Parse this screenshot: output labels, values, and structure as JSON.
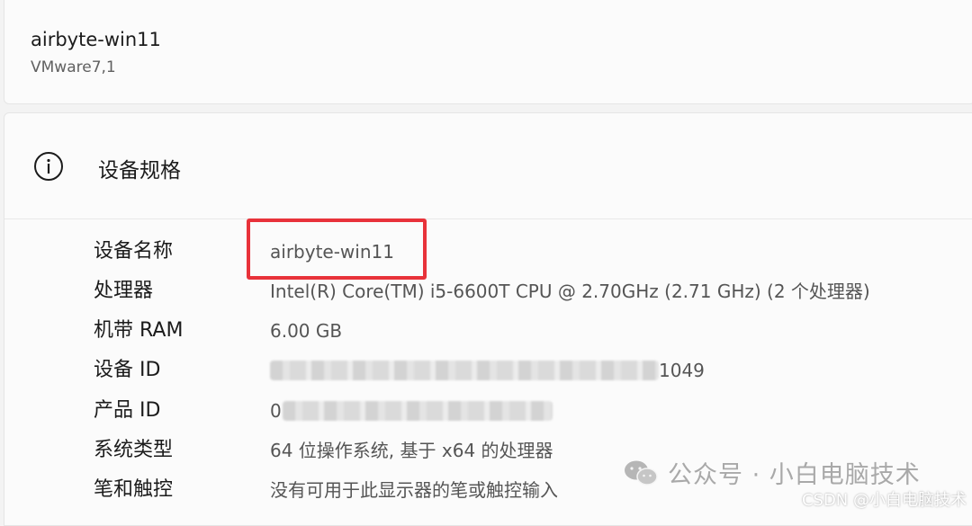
{
  "device": {
    "name": "airbyte-win11",
    "model": "VMware7,1"
  },
  "spec": {
    "title": "设备规格",
    "icon": "info-icon",
    "rows": [
      {
        "label": "设备名称",
        "value": "airbyte-win11"
      },
      {
        "label": "处理器",
        "value": "Intel(R) Core(TM) i5-6600T CPU @ 2.70GHz (2.71 GHz) (2 个处理器)"
      },
      {
        "label": "机带 RAM",
        "value": "6.00 GB"
      },
      {
        "label": "设备 ID",
        "value": "1049"
      },
      {
        "label": "产品 ID",
        "value": "0"
      },
      {
        "label": "系统类型",
        "value": "64 位操作系统, 基于 x64 的处理器"
      },
      {
        "label": "笔和触控",
        "value": "没有可用于此显示器的笔或触控输入"
      }
    ]
  },
  "watermark": {
    "text": "公众号 · 小白电脑技术",
    "csdn": "CSDN @小白电脑技术"
  },
  "colors": {
    "highlight": "#e8323a",
    "background": "#f3f3f3",
    "card": "#fbfbfb"
  }
}
